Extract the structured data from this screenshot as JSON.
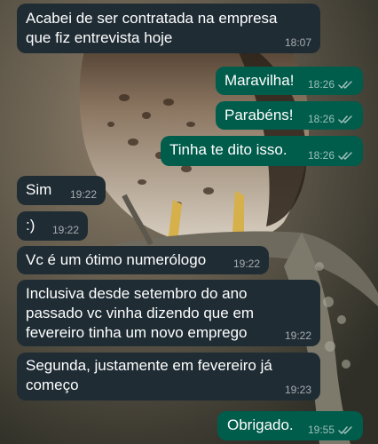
{
  "messages": [
    {
      "direction": "incoming",
      "text": "Acabei de ser contratada na empresa\nque fiz entrevista hoje",
      "time": "18:07"
    },
    {
      "direction": "outgoing",
      "text": "Maravilha!",
      "time": "18:26",
      "status": "read-double-check-icon"
    },
    {
      "direction": "outgoing",
      "text": "Parabéns!",
      "time": "18:26",
      "status": "read-double-check-icon"
    },
    {
      "direction": "outgoing",
      "text": "Tinha te dito isso.",
      "time": "18:26",
      "status": "read-double-check-icon"
    },
    {
      "direction": "incoming",
      "text": "Sim",
      "time": "19:22"
    },
    {
      "direction": "incoming",
      "text": ":)",
      "time": "19:22"
    },
    {
      "direction": "incoming",
      "text": "Vc é um ótimo numerólogo",
      "time": "19:22"
    },
    {
      "direction": "incoming",
      "text": "Inclusiva desde setembro do ano\npassado vc vinha dizendo que em\nfevereiro tinha um novo emprego",
      "time": "19:22"
    },
    {
      "direction": "incoming",
      "text": "Segunda, justamente em fevereiro já\ncomeço",
      "time": "19:23"
    },
    {
      "direction": "outgoing",
      "text": "Obrigado.",
      "time": "19:55",
      "status": "read-double-check-icon"
    }
  ],
  "colors": {
    "incoming_bubble": "#1f2c34",
    "outgoing_bubble": "#005c4b",
    "text": "#ffffff"
  },
  "wallpaper": "hawk-on-branch-photo"
}
